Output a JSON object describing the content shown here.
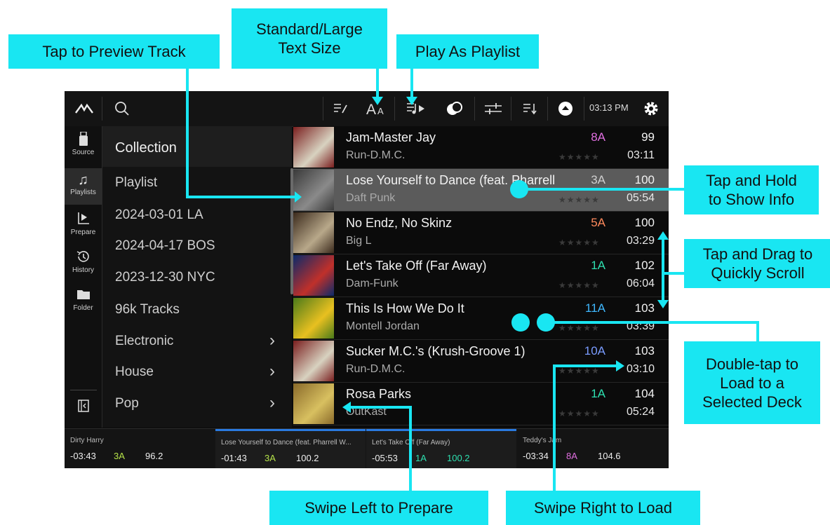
{
  "callouts": {
    "preview": "Tap to Preview Track",
    "text_size": "Standard/Large\nText Size",
    "play_playlist": "Play As Playlist",
    "hold_info": "Tap and Hold\nto Show Info",
    "drag_scroll": "Tap and Drag to\nQuickly Scroll",
    "double_tap": "Double-tap to\nLoad to a\nSelected Deck",
    "swipe_left": "Swipe Left to Prepare",
    "swipe_right": "Swipe Right to Load"
  },
  "topbar": {
    "clock": "03:13 PM"
  },
  "nav": {
    "source": "Source",
    "playlists": "Playlists",
    "prepare": "Prepare",
    "history": "History",
    "folder": "Folder"
  },
  "list": {
    "header": "Collection",
    "items": [
      "Playlist",
      "2024-03-01 LA",
      "2024-04-17 BOS",
      "2023-12-30 NYC",
      "96k Tracks",
      "Electronic",
      "House",
      "Pop"
    ]
  },
  "tracks": [
    {
      "title": "Jam-Master Jay",
      "artist": "Run-D.M.C.",
      "key": "8A",
      "key_color": "#e06fe0",
      "bpm": "99",
      "time": "03:11",
      "art": [
        "#7a1e1e",
        "#d8d2c0"
      ]
    },
    {
      "title": "Lose Yourself to Dance (feat. Pharrell Williams)",
      "artist": "Daft Punk",
      "key": "3A",
      "key_color": "#cfcfcf",
      "bpm": "100",
      "time": "05:54",
      "art": [
        "#3a3a3a",
        "#8a8a8a"
      ]
    },
    {
      "title": "No Endz, No Skinz",
      "artist": "Big L",
      "key": "5A",
      "key_color": "#ff8a5c",
      "bpm": "100",
      "time": "03:29",
      "art": [
        "#3b2a1c",
        "#b8a88a"
      ]
    },
    {
      "title": "Let's Take Off (Far Away)",
      "artist": "Dam-Funk",
      "key": "1A",
      "key_color": "#2ee0b0",
      "bpm": "102",
      "time": "06:04",
      "art": [
        "#0a2a6a",
        "#c0302a"
      ]
    },
    {
      "title": "This Is How We Do It",
      "artist": "Montell Jordan",
      "key": "11A",
      "key_color": "#3fb8ff",
      "bpm": "103",
      "time": "03:39",
      "art": [
        "#4a7a1a",
        "#e8c020"
      ]
    },
    {
      "title": "Sucker M.C.'s (Krush-Groove 1)",
      "artist": "Run-D.M.C.",
      "key": "10A",
      "key_color": "#7a9cff",
      "bpm": "103",
      "time": "03:10",
      "art": [
        "#7a1e1e",
        "#d8d2c0"
      ]
    },
    {
      "title": "Rosa Parks",
      "artist": "OutKast",
      "key": "1A",
      "key_color": "#2ee0b0",
      "bpm": "104",
      "time": "05:24",
      "art": [
        "#8a6a2a",
        "#d8c060"
      ]
    }
  ],
  "decks": [
    {
      "title": "Dirty Harry",
      "time": "-03:43",
      "key": "3A",
      "key_color": "#b6e34a",
      "bpm": "96.2",
      "bpm_color": "#eeeeee"
    },
    {
      "title": "Lose Yourself to Dance (feat. Pharrell W...",
      "time": "-01:43",
      "key": "3A",
      "key_color": "#b6e34a",
      "bpm": "100.2",
      "bpm_color": "#eeeeee"
    },
    {
      "title": "Let's Take Off (Far Away)",
      "time": "-05:53",
      "key": "1A",
      "key_color": "#2ee0b0",
      "bpm": "100.2",
      "bpm_color": "#2ee0b0"
    },
    {
      "title": "Teddy's Jam",
      "time": "-03:34",
      "key": "8A",
      "key_color": "#e06fe0",
      "bpm": "104.6",
      "bpm_color": "#eeeeee"
    }
  ]
}
